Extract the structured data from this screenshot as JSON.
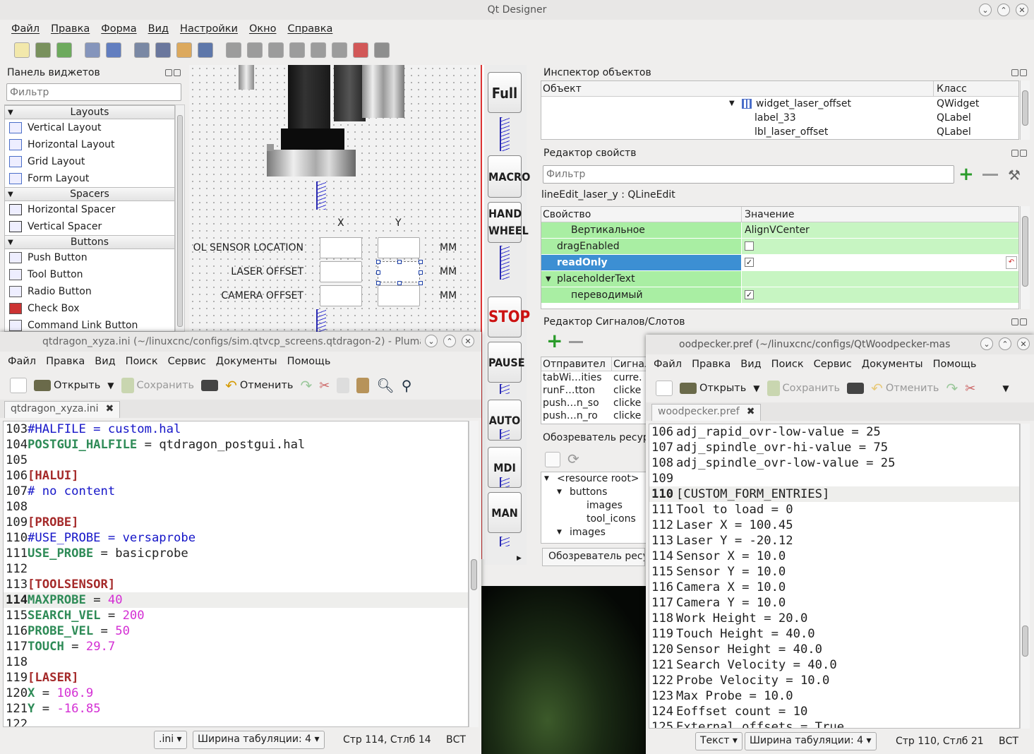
{
  "designer": {
    "title": "Qt Designer",
    "menu": [
      "Файл",
      "Правка",
      "Форма",
      "Вид",
      "Настройки",
      "Окно",
      "Справка"
    ],
    "widget_box": {
      "title": "Панель виджетов",
      "filter_placeholder": "Фильтр",
      "groups": [
        {
          "name": "Layouts",
          "items": [
            "Vertical Layout",
            "Horizontal Layout",
            "Grid Layout",
            "Form Layout"
          ]
        },
        {
          "name": "Spacers",
          "items": [
            "Horizontal Spacer",
            "Vertical Spacer"
          ]
        },
        {
          "name": "Buttons",
          "items": [
            "Push Button",
            "Tool Button",
            "Radio Button",
            "Check Box",
            "Command Link Button"
          ]
        }
      ]
    },
    "form": {
      "col_x": "X",
      "col_y": "Y",
      "rows": [
        {
          "label": "OL SENSOR LOCATION",
          "unit": "MM"
        },
        {
          "label": "LASER OFFSET",
          "unit": "MM"
        },
        {
          "label": "CAMERA OFFSET",
          "unit": "MM"
        }
      ],
      "side_buttons": [
        "Full",
        "MACRO",
        "HAND WHEEL",
        "STOP",
        "PAUSE",
        "AUTO",
        "MDI",
        "MAN"
      ]
    },
    "object_inspector": {
      "title": "Инспектор объектов",
      "col_object": "Объект",
      "col_class": "Класс",
      "rows": [
        {
          "name": "widget_laser_offset",
          "cls": "QWidget"
        },
        {
          "name": "label_33",
          "cls": "QLabel"
        },
        {
          "name": "lbl_laser_offset",
          "cls": "QLabel"
        }
      ]
    },
    "property_editor": {
      "title": "Редактор свойств",
      "filter_placeholder": "Фильтр",
      "object_line": "lineEdit_laser_y : QLineEdit",
      "col_property": "Свойство",
      "col_value": "Значение",
      "rows": [
        {
          "name": "Вертикальное",
          "value": "AlignVCenter"
        },
        {
          "name": "dragEnabled",
          "value": ""
        },
        {
          "name": "readOnly",
          "value": ""
        },
        {
          "name": "placeholderText",
          "value": ""
        },
        {
          "name": "переводимый",
          "value": ""
        }
      ]
    },
    "signal_editor": {
      "title": "Редактор Сигналов/Слотов",
      "col_sender": "Отправител",
      "col_signal": "Сигнал",
      "rows": [
        {
          "sender": "tabWi…ities",
          "signal": "curre."
        },
        {
          "sender": "runF…tton",
          "signal": "clicke"
        },
        {
          "sender": "push…n_so",
          "signal": "clicke"
        },
        {
          "sender": "push…n_ro",
          "signal": "clicke"
        }
      ]
    },
    "resource_browser": {
      "title": "Обозреватель ресур",
      "tab_label": "Обозреватель ресур",
      "tree": [
        "<resource root>",
        "buttons",
        "images",
        "tool_icons",
        "images"
      ]
    }
  },
  "pluma_left": {
    "title": "qtdragon_xyza.ini (~/linuxcnc/configs/sim.qtvcp_screens.qtdragon-2) - Pluma",
    "menu": [
      "Файл",
      "Правка",
      "Вид",
      "Поиск",
      "Сервис",
      "Документы",
      "Помощь"
    ],
    "toolbar": {
      "open": "Открыть",
      "save": "Сохранить",
      "undo": "Отменить"
    },
    "tab": "qtdragon_xyza.ini",
    "status": {
      "lang": ".ini",
      "tab_width": "Ширина табуляции:  4",
      "pos": "Стр 114, Стлб 14",
      "mode": "ВСТ"
    },
    "lines": [
      {
        "n": "103",
        "t": "#HALFILE = custom.hal",
        "k": "comment"
      },
      {
        "n": "104",
        "t": "POSTGUI_HALFILE = qtdragon_postgui.hal",
        "k": "kv",
        "key": "POSTGUI_HALFILE",
        "val": "qtdragon_postgui.hal"
      },
      {
        "n": "105",
        "t": "",
        "k": "plain"
      },
      {
        "n": "106",
        "t": "[HALUI]",
        "k": "section"
      },
      {
        "n": "107",
        "t": "# no content",
        "k": "comment"
      },
      {
        "n": "108",
        "t": "",
        "k": "plain"
      },
      {
        "n": "109",
        "t": "[PROBE]",
        "k": "section"
      },
      {
        "n": "110",
        "t": "#USE_PROBE = versaprobe",
        "k": "comment"
      },
      {
        "n": "111",
        "t": "USE_PROBE = basicprobe",
        "k": "kv",
        "key": "USE_PROBE",
        "val": "basicprobe"
      },
      {
        "n": "112",
        "t": "",
        "k": "plain"
      },
      {
        "n": "113",
        "t": "[TOOLSENSOR]",
        "k": "section"
      },
      {
        "n": "114",
        "t": "MAXPROBE = 40",
        "k": "kvn",
        "key": "MAXPROBE",
        "val": "40"
      },
      {
        "n": "115",
        "t": "SEARCH_VEL = 200",
        "k": "kvn",
        "key": "SEARCH_VEL",
        "val": "200"
      },
      {
        "n": "116",
        "t": "PROBE_VEL = 50",
        "k": "kvn",
        "key": "PROBE_VEL",
        "val": "50"
      },
      {
        "n": "117",
        "t": "TOUCH = 29.7",
        "k": "kvn",
        "key": "TOUCH",
        "val": "29.7"
      },
      {
        "n": "118",
        "t": "",
        "k": "plain"
      },
      {
        "n": "119",
        "t": "[LASER]",
        "k": "section"
      },
      {
        "n": "120",
        "t": "X = 106.9",
        "k": "kvn",
        "key": "X",
        "val": "106.9"
      },
      {
        "n": "121",
        "t": "Y = -16.85",
        "k": "kvn",
        "key": "Y",
        "val": "-16.85"
      },
      {
        "n": "122",
        "t": "",
        "k": "plain"
      }
    ]
  },
  "pluma_right": {
    "title": "oodpecker.pref (~/linuxcnc/configs/QtWoodpecker-mas",
    "menu": [
      "Файл",
      "Правка",
      "Вид",
      "Поиск",
      "Сервис",
      "Документы",
      "Помощь"
    ],
    "toolbar": {
      "open": "Открыть",
      "save": "Сохранить",
      "undo": "Отменить"
    },
    "tab": "woodpecker.pref",
    "status": {
      "lang": "Текст",
      "tab_width": "Ширина табуляции:  4",
      "pos": "Стр 110, Стлб 21",
      "mode": "ВСТ"
    },
    "lines": [
      {
        "n": "106",
        "t": "adj_rapid_ovr-low-value = 25"
      },
      {
        "n": "107",
        "t": "adj_spindle_ovr-hi-value = 75"
      },
      {
        "n": "108",
        "t": "adj_spindle_ovr-low-value = 25"
      },
      {
        "n": "109",
        "t": ""
      },
      {
        "n": "110",
        "t": "[CUSTOM_FORM_ENTRIES]"
      },
      {
        "n": "111",
        "t": "Tool to load = 0"
      },
      {
        "n": "112",
        "t": "Laser X = 100.45"
      },
      {
        "n": "113",
        "t": "Laser Y = -20.12"
      },
      {
        "n": "114",
        "t": "Sensor X = 10.0"
      },
      {
        "n": "115",
        "t": "Sensor Y = 10.0"
      },
      {
        "n": "116",
        "t": "Camera X = 10.0"
      },
      {
        "n": "117",
        "t": "Camera Y = 10.0"
      },
      {
        "n": "118",
        "t": "Work Height = 20.0"
      },
      {
        "n": "119",
        "t": "Touch Height = 40.0"
      },
      {
        "n": "120",
        "t": "Sensor Height = 40.0"
      },
      {
        "n": "121",
        "t": "Search Velocity = 40.0"
      },
      {
        "n": "122",
        "t": "Probe Velocity = 10.0"
      },
      {
        "n": "123",
        "t": "Max Probe = 10.0"
      },
      {
        "n": "124",
        "t": "Eoffset count = 10"
      },
      {
        "n": "125",
        "t": "External offsets = True"
      }
    ]
  }
}
